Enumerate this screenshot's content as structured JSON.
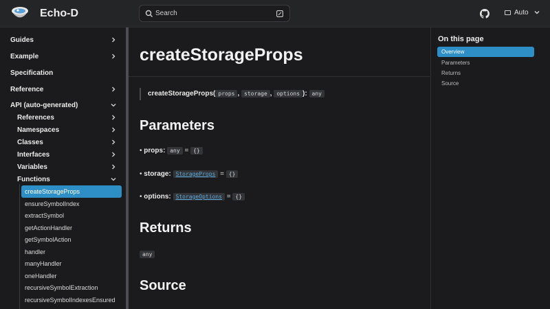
{
  "navbar": {
    "brand": "Echo-D",
    "search_label": "Search",
    "theme_label": "Auto"
  },
  "sidebar": {
    "items": [
      {
        "label": "Guides",
        "expandable": true
      },
      {
        "label": "Example",
        "expandable": true
      },
      {
        "label": "Specification",
        "expandable": false
      },
      {
        "label": "Reference",
        "expandable": true
      },
      {
        "label": "API (auto-generated)",
        "expandable": true,
        "expanded": true
      }
    ],
    "api_children": [
      {
        "label": "References"
      },
      {
        "label": "Namespaces"
      },
      {
        "label": "Classes"
      },
      {
        "label": "Interfaces"
      },
      {
        "label": "Variables"
      },
      {
        "label": "Functions",
        "expanded": true
      }
    ],
    "functions": [
      "createStorageProps",
      "ensureSymbolIndex",
      "extractSymbol",
      "getActionHandler",
      "getSymbolAction",
      "handler",
      "manyHandler",
      "oneHandler",
      "recursiveSymbolExtraction",
      "recursiveSymbolIndexesEnsured"
    ],
    "active_function": "createStorageProps"
  },
  "main": {
    "title": "createStorageProps",
    "signature": {
      "name": "createStorageProps",
      "open": "(",
      "sep": ",",
      "close": "):",
      "args": [
        "props",
        "storage",
        "options"
      ],
      "return_type": "any"
    },
    "sections": {
      "parameters": "Parameters",
      "returns": "Returns",
      "source": "Source"
    },
    "params": [
      {
        "bullet": "•",
        "name": "props",
        "colon": ":",
        "type": "any",
        "is_link": false,
        "equals": "=",
        "default": "{}"
      },
      {
        "bullet": "•",
        "name": "storage",
        "colon": ":",
        "type": "StorageProps",
        "is_link": true,
        "equals": "=",
        "default": "{}"
      },
      {
        "bullet": "•",
        "name": "options",
        "colon": ":",
        "type": "StorageOptions",
        "is_link": true,
        "equals": "=",
        "default": "{}"
      }
    ],
    "returns_type": "any"
  },
  "toc": {
    "title": "On this page",
    "items": [
      "Overview",
      "Parameters",
      "Returns",
      "Source"
    ],
    "active": "Overview"
  },
  "colors": {
    "accent": "#2e8fc6",
    "background": "#1b1b1d",
    "navbar": "#242526",
    "link": "#5aa9de"
  }
}
